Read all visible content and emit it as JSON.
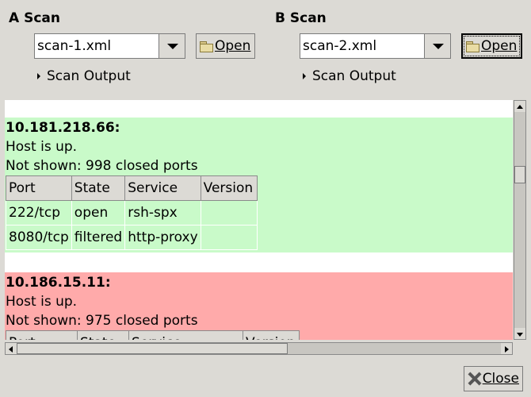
{
  "scan_a": {
    "title": "A Scan",
    "file": "scan-1.xml",
    "open_label": "Open",
    "output_label": "Scan Output"
  },
  "scan_b": {
    "title": "B Scan",
    "file": "scan-2.xml",
    "open_label": "Open",
    "output_label": "Scan Output"
  },
  "results": {
    "columns": [
      "Port",
      "State",
      "Service",
      "Version"
    ],
    "hosts": [
      {
        "address": "10.181.218.66:",
        "status": "Host is up.",
        "not_shown": "Not shown: 998 closed ports",
        "color": "#c9fac9",
        "rows": [
          {
            "port": "222/tcp",
            "state": "open",
            "service": "rsh-spx",
            "version": ""
          },
          {
            "port": "8080/tcp",
            "state": "filtered",
            "service": "http-proxy",
            "version": ""
          }
        ]
      },
      {
        "address": "10.186.15.11:",
        "status": "Host is up.",
        "not_shown": "Not shown: 975 closed ports",
        "color": "#ffaaaa",
        "rows": []
      }
    ]
  },
  "footer": {
    "close_label": "Close"
  }
}
